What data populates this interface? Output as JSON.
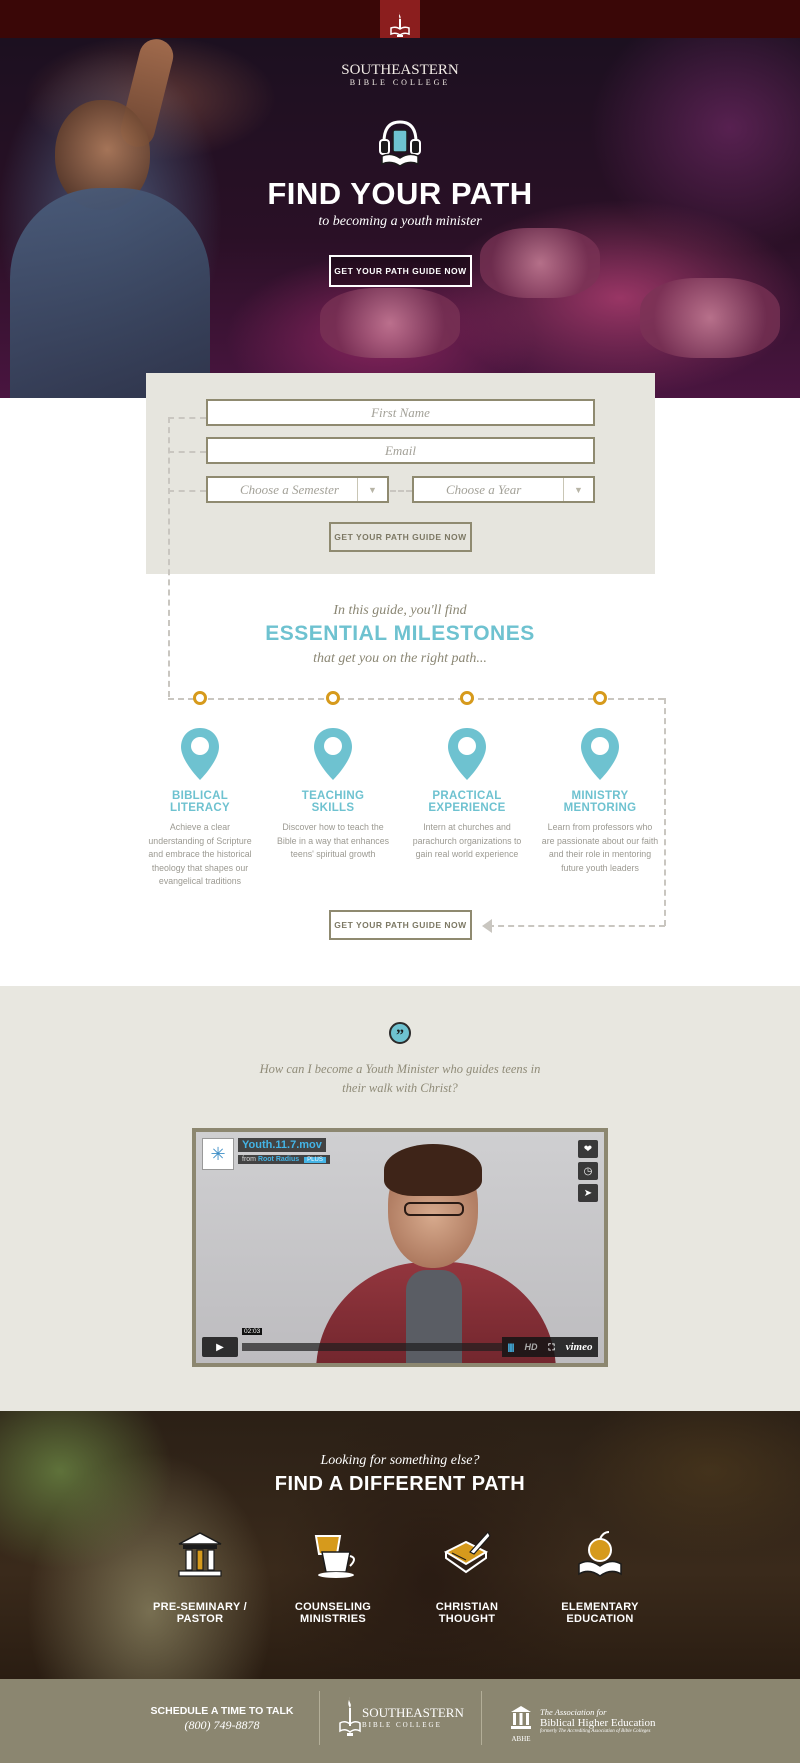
{
  "brand": {
    "name": "SOUTHEASTERN",
    "tagline": "BIBLE COLLEGE"
  },
  "hero": {
    "title": "FIND YOUR PATH",
    "subtitle": "to becoming a youth minister",
    "cta_label": "GET YOUR PATH GUIDE NOW"
  },
  "form": {
    "first_name_placeholder": "First Name",
    "email_placeholder": "Email",
    "semester_placeholder": "Choose a Semester",
    "year_placeholder": "Choose a Year",
    "submit_label": "GET YOUR PATH GUIDE NOW"
  },
  "guide": {
    "intro": "In this guide, you'll find",
    "title": "ESSENTIAL MILESTONES",
    "outro": "that get you on the right path...",
    "milestones": [
      {
        "title_line1": "BIBLICAL",
        "title_line2": "LITERACY",
        "text": "Achieve a clear understanding of Scripture and embrace the historical theology that shapes our evangelical traditions"
      },
      {
        "title_line1": "TEACHING",
        "title_line2": "SKILLS",
        "text": "Discover how to teach the Bible in a way that enhances teens' spiritual growth"
      },
      {
        "title_line1": "PRACTICAL",
        "title_line2": "EXPERIENCE",
        "text": "Intern at churches and parachurch organizations to gain real world experience"
      },
      {
        "title_line1": "MINISTRY",
        "title_line2": "MENTORING",
        "text": "Learn from professors who are passionate about our faith and their role in mentoring future youth leaders"
      }
    ],
    "cta_label": "GET YOUR PATH GUIDE NOW"
  },
  "quote": {
    "mark": "”",
    "text": "How can I become a Youth Minister who guides teens in their walk with Christ?"
  },
  "video": {
    "title": "Youth.11.7.mov",
    "from_prefix": "from",
    "author": "Root Radius",
    "badge": "PLUS",
    "time": "02:03",
    "hd": "HD",
    "provider": "vimeo"
  },
  "other_paths": {
    "subtitle": "Looking for something else?",
    "title": "FIND A DIFFERENT PATH",
    "items": [
      {
        "line1": "PRE-SEMINARY /",
        "line2": "PASTOR"
      },
      {
        "line1": "COUNSELING",
        "line2": "MINISTRIES"
      },
      {
        "line1": "CHRISTIAN",
        "line2": "THOUGHT"
      },
      {
        "line1": "ELEMENTARY",
        "line2": "EDUCATION"
      }
    ]
  },
  "footer": {
    "cta_line1": "SCHEDULE A TIME TO TALK",
    "phone": "(800) 749-8878",
    "logo_name": "SOUTHEASTERN",
    "logo_tagline": "BIBLE COLLEGE",
    "abhe_intro": "The Association for",
    "abhe_name": "Biblical Higher Education",
    "abhe_formerly": "formerly The Accrediting Association of Bible Colleges",
    "abhe_abbr": "ABHE"
  },
  "colors": {
    "top_bar": "#3a0707",
    "logo_tab": "#8b1e1e",
    "accent_teal": "#6ec2d0",
    "accent_gold": "#d69a1c",
    "olive": "#8b8670",
    "panel": "#e6e5de"
  },
  "icons": {
    "logo": "book-and-torch-icon",
    "hero": "headphones-book-icon",
    "milestone": "map-pin-icon",
    "quote": "quote-icon",
    "paths": [
      "temple-columns-icon",
      "coffee-cups-icon",
      "book-quill-icon",
      "apple-book-icon"
    ]
  }
}
